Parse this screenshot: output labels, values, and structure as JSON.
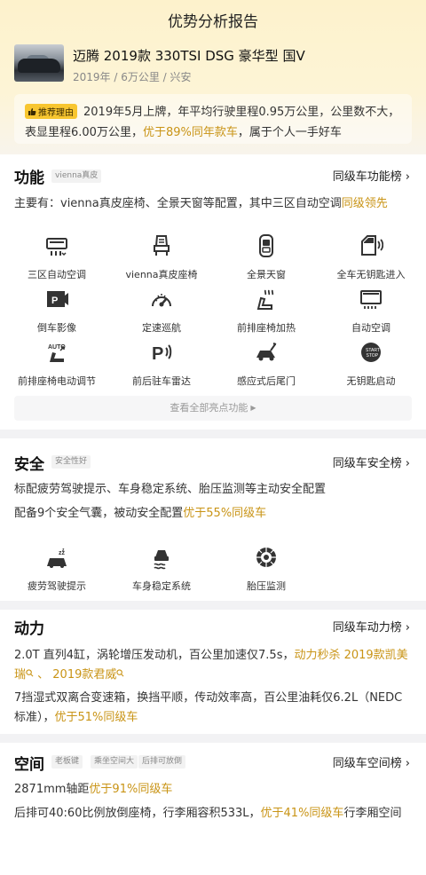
{
  "page": {
    "title": "优势分析报告"
  },
  "car": {
    "name": "迈腾 2019款 330TSI DSG 豪华型 国V",
    "meta": "2019年 / 6万公里 / 兴安"
  },
  "reason": {
    "tag": "推荐理由",
    "text_a": "2019年5月上牌，年平均行驶里程0.95万公里，公里数不大，表显里程6.00万公里，",
    "text_hl": "优于89%同年款车",
    "text_b": "，属于个人一手好车"
  },
  "function": {
    "title": "功能",
    "tag": "vienna真皮",
    "link": "同级车功能榜",
    "summary_a": "主要有：vienna真皮座椅、全景天窗等配置，其中三区自动空调",
    "summary_hl": "同级领先",
    "features": [
      {
        "label": "三区自动空调",
        "icon": "ac-three-zone-icon"
      },
      {
        "label": "vienna真皮座椅",
        "icon": "leather-seat-icon"
      },
      {
        "label": "全景天窗",
        "icon": "panoramic-sunroof-icon"
      },
      {
        "label": "全车无钥匙进入",
        "icon": "keyless-entry-icon"
      },
      {
        "label": "倒车影像",
        "icon": "reverse-camera-icon"
      },
      {
        "label": "定速巡航",
        "icon": "cruise-control-icon"
      },
      {
        "label": "前排座椅加热",
        "icon": "seat-heating-icon"
      },
      {
        "label": "自动空调",
        "icon": "auto-ac-icon"
      },
      {
        "label": "前排座椅电动调节",
        "icon": "power-seat-icon"
      },
      {
        "label": "前后驻车雷达",
        "icon": "parking-radar-icon"
      },
      {
        "label": "感应式后尾门",
        "icon": "smart-tailgate-icon"
      },
      {
        "label": "无钥匙启动",
        "icon": "keyless-start-icon"
      }
    ],
    "view_all": "查看全部亮点功能"
  },
  "safety": {
    "title": "安全",
    "tag": "安全性好",
    "link": "同级车安全榜",
    "line1": "标配疲劳驾驶提示、车身稳定系统、胎压监测等主动安全配置",
    "line2_a": "配备9个安全气囊，被动安全配置",
    "line2_hl": "优于55%同级车",
    "features": [
      {
        "label": "疲劳驾驶提示",
        "icon": "fatigue-warning-icon"
      },
      {
        "label": "车身稳定系统",
        "icon": "stability-control-icon"
      },
      {
        "label": "胎压监测",
        "icon": "tire-pressure-icon"
      }
    ]
  },
  "power": {
    "title": "动力",
    "link": "同级车动力榜",
    "line1_a": "2.0T 直列4缸，涡轮增压发动机，百公里加速仅7.5s，",
    "line1_hl_a": "动力秒杀 2019款凯美瑞",
    "line1_sep": " 、 ",
    "line1_hl_b": "2019款君威",
    "line2_a": "7挡湿式双离合变速箱，换挡平顺，传动效率高，百公里油耗仅6.2L（NEDC标准），",
    "line2_hl": "优于51%同级车"
  },
  "space": {
    "title": "空间",
    "tags": [
      "老板键",
      "乘坐空间大",
      "后排可放倒"
    ],
    "link": "同级车空间榜",
    "line1_a": "2871mm轴距",
    "line1_hl": "优于91%同级车",
    "line2_a": "后排可40:60比例放倒座椅，行李厢容积533L，",
    "line2_hl": "优于41%同级车",
    "line2_b": "行李厢空间"
  },
  "colors": {
    "accent": "#c99416",
    "tag_yellow": "#f8c630"
  }
}
